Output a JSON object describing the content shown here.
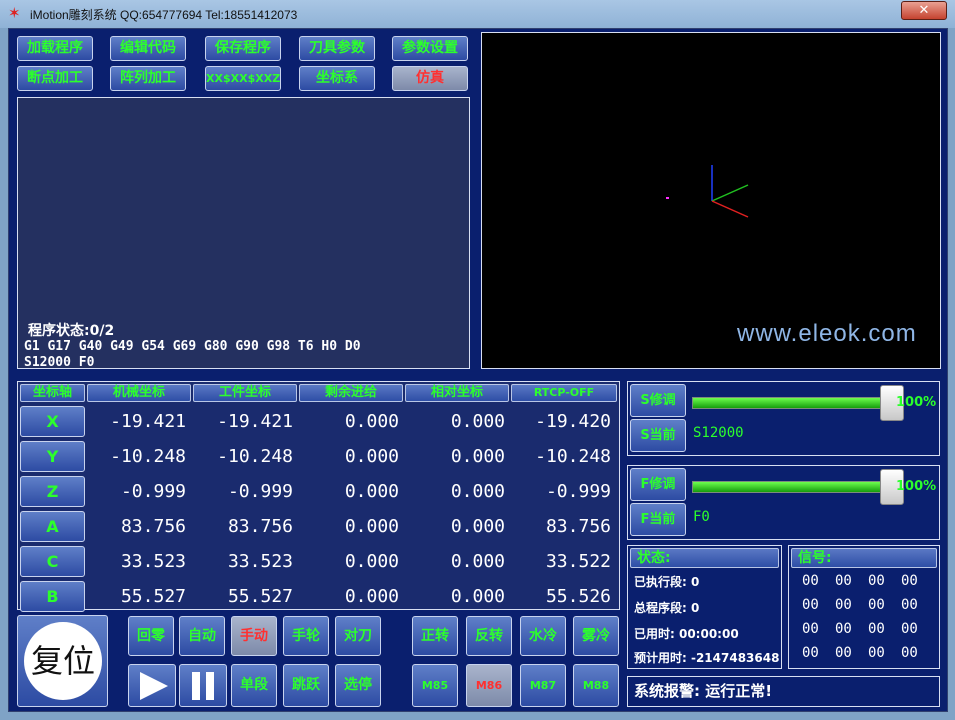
{
  "window": {
    "title": "iMotion雕刻系统 QQ:654777694 Tel:18551412073",
    "close_label": "✕"
  },
  "toolbar": {
    "row1": [
      "加载程序",
      "编辑代码",
      "保存程序",
      "刀具参数",
      "参数设置"
    ],
    "row2": [
      "断点加工",
      "阵列加工",
      "XX$XX$XXZ",
      "坐标系",
      "仿真"
    ]
  },
  "code": {
    "status": "程序状态:0/2",
    "line1": "G1 G17 G40 G49 G54 G69 G80 G90 G98 T6 H0 D0",
    "line2": "S12000 F0"
  },
  "watermark": "www.eleok.com",
  "coord": {
    "headers": [
      "坐标轴",
      "机械坐标",
      "工件坐标",
      "剩余进给",
      "相对坐标",
      "RTCP-OFF"
    ],
    "rows": [
      {
        "axis": "X",
        "v": [
          "-19.421",
          "-19.421",
          "0.000",
          "0.000",
          "-19.420"
        ]
      },
      {
        "axis": "Y",
        "v": [
          "-10.248",
          "-10.248",
          "0.000",
          "0.000",
          "-10.248"
        ]
      },
      {
        "axis": "Z",
        "v": [
          "-0.999",
          "-0.999",
          "0.000",
          "0.000",
          "-0.999"
        ]
      },
      {
        "axis": "A",
        "v": [
          "83.756",
          "83.756",
          "0.000",
          "0.000",
          "83.756"
        ]
      },
      {
        "axis": "C",
        "v": [
          "33.523",
          "33.523",
          "0.000",
          "0.000",
          "33.522"
        ]
      },
      {
        "axis": "B",
        "v": [
          "55.527",
          "55.527",
          "0.000",
          "0.000",
          "55.526"
        ]
      }
    ]
  },
  "control": {
    "reset": "复位",
    "mode_row": [
      "回零",
      "自动",
      "手动",
      "手轮",
      "对刀"
    ],
    "mode2_row": [
      "单段",
      "跳跃",
      "选停"
    ],
    "spindle_row": [
      "正转",
      "反转",
      "水冷",
      "雾冷"
    ],
    "m_row": [
      "M85",
      "M86",
      "M87",
      "M88"
    ]
  },
  "spindle": {
    "adjust_label": "S修调",
    "current_label": "S当前",
    "percent": "100%",
    "current_value": "S12000",
    "level": 1.0
  },
  "feed": {
    "adjust_label": "F修调",
    "current_label": "F当前",
    "percent": "100%",
    "current_value": "F0",
    "level": 1.0
  },
  "status": {
    "title": "状态:",
    "executed": "已执行段: 0",
    "total": "总程序段: 0",
    "elapsed": "已用时: 00:00:00",
    "estimate": "预计用时: -2147483648"
  },
  "signal": {
    "title": "信号:",
    "values": [
      [
        "00",
        "00",
        "00",
        "00"
      ],
      [
        "00",
        "00",
        "00",
        "00"
      ],
      [
        "00",
        "00",
        "00",
        "00"
      ],
      [
        "00",
        "00",
        "00",
        "00"
      ]
    ]
  },
  "alarm": "系统报警: 运行正常!"
}
